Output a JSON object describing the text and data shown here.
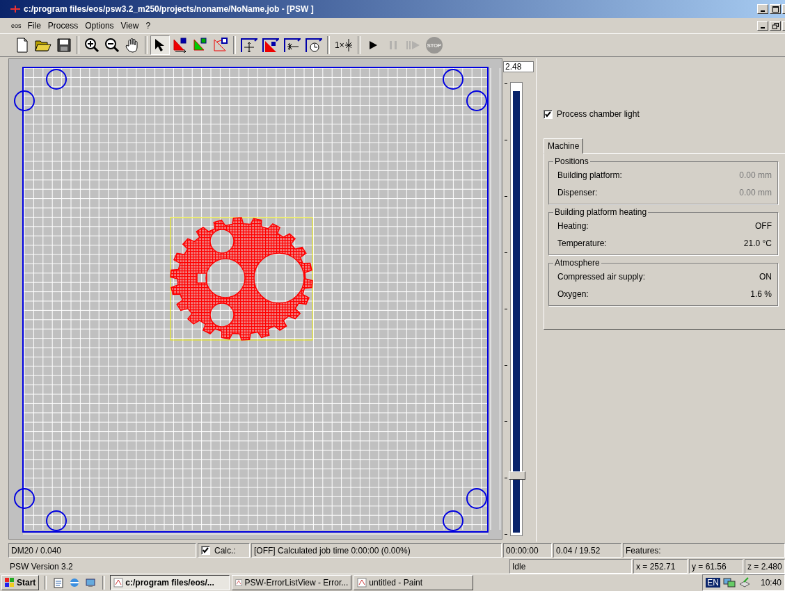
{
  "window": {
    "title": "c:/program files/eos/psw3.2_m250/projects/noname/NoName.job - [PSW ]"
  },
  "menu": {
    "logo": "eos",
    "items": [
      "File",
      "Process",
      "Options",
      "View",
      "?"
    ]
  },
  "toolbar": [
    {
      "kind": "new",
      "pressed": false,
      "disabled": false
    },
    {
      "kind": "open",
      "pressed": false,
      "disabled": false
    },
    {
      "kind": "save",
      "pressed": false,
      "disabled": false
    },
    {
      "kind": "sep"
    },
    {
      "kind": "zoom-in",
      "pressed": false,
      "disabled": false
    },
    {
      "kind": "zoom-out",
      "pressed": false,
      "disabled": false
    },
    {
      "kind": "hand",
      "pressed": false,
      "disabled": false
    },
    {
      "kind": "sep"
    },
    {
      "kind": "pointer",
      "pressed": true,
      "disabled": false
    },
    {
      "kind": "move-part",
      "pressed": false,
      "disabled": false
    },
    {
      "kind": "scale-part",
      "pressed": false,
      "disabled": false
    },
    {
      "kind": "edit-part",
      "pressed": false,
      "disabled": false
    },
    {
      "kind": "sep"
    },
    {
      "kind": "center",
      "pressed": false,
      "disabled": false
    },
    {
      "kind": "place",
      "pressed": false,
      "disabled": false
    },
    {
      "kind": "exposure",
      "pressed": false,
      "disabled": false
    },
    {
      "kind": "timer",
      "pressed": false,
      "disabled": false
    },
    {
      "kind": "sep"
    },
    {
      "kind": "single",
      "label": "1×",
      "pressed": false,
      "disabled": false
    },
    {
      "kind": "sep"
    },
    {
      "kind": "play",
      "pressed": false,
      "disabled": false
    },
    {
      "kind": "pause",
      "pressed": false,
      "disabled": true
    },
    {
      "kind": "step",
      "pressed": false,
      "disabled": true
    },
    {
      "kind": "stop",
      "label": "STOP",
      "pressed": false,
      "disabled": true
    }
  ],
  "layer_slider": {
    "value": "2.48",
    "level": 0.13
  },
  "panel": {
    "checkbox": {
      "label": "Process chamber light",
      "checked": true
    },
    "tabs": [
      {
        "label": "Machine",
        "selected": true
      }
    ],
    "groups": [
      {
        "title": "Positions",
        "rows": [
          {
            "label": "Building platform:",
            "value": "0.00 mm",
            "disabled": true
          },
          {
            "label": "Dispenser:",
            "value": "0.00 mm",
            "disabled": true
          }
        ]
      },
      {
        "title": "Building platform heating",
        "rows": [
          {
            "label": "Heating:",
            "value": "OFF",
            "disabled": false
          },
          {
            "label": "Temperature:",
            "value": "21.0 °C",
            "disabled": false
          }
        ]
      },
      {
        "title": "Atmosphere",
        "rows": [
          {
            "label": "Compressed air supply:",
            "value": "ON",
            "disabled": false
          },
          {
            "label": "Oxygen:",
            "value": "1.6 %",
            "disabled": false
          }
        ]
      }
    ]
  },
  "status_bar": {
    "material": "DM20 / 0.040",
    "calc": {
      "label": "Calc.:",
      "checked": true
    },
    "job_time": "[OFF]  Calculated job time 0:00:00  (0.00%)",
    "time": "00:00:00",
    "height": "0.04 /  19.52",
    "features": "Features:"
  },
  "status_bar_2": {
    "version": "PSW Version 3.2",
    "state": "Idle",
    "x": "x = 252.71",
    "y": "y = 61.56",
    "z": "z = 2.480"
  },
  "taskbar": {
    "start": "Start",
    "tasks": [
      {
        "label": "c:/program files/eos/...",
        "selected": true
      },
      {
        "label": "PSW-ErrorListView - Error...",
        "selected": false
      },
      {
        "label": "untitled - Paint",
        "selected": false
      }
    ],
    "language": "EN",
    "clock": "10:40"
  }
}
